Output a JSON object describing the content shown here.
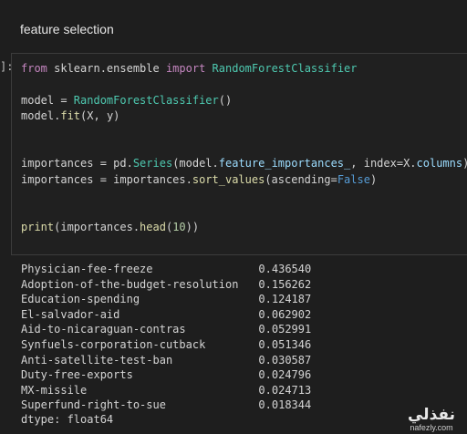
{
  "notebook": {
    "markdown_heading": "feature selection",
    "cell_prompt": "]:"
  },
  "code_cell": {
    "lines": [
      "from sklearn.ensemble import RandomForestClassifier",
      "",
      "model = RandomForestClassifier()",
      "model.fit(X, y)",
      "",
      "",
      "importances = pd.Series(model.feature_importances_, index=X.columns)",
      "importances = importances.sort_values(ascending=False)",
      "",
      "",
      "print(importances.head(10))"
    ]
  },
  "output": {
    "rows": [
      {
        "feature": "Physician-fee-freeze",
        "value": "0.436540"
      },
      {
        "feature": "Adoption-of-the-budget-resolution",
        "value": "0.156262"
      },
      {
        "feature": "Education-spending",
        "value": "0.124187"
      },
      {
        "feature": "El-salvador-aid",
        "value": "0.062902"
      },
      {
        "feature": "Aid-to-nicaraguan-contras",
        "value": "0.052991"
      },
      {
        "feature": "Synfuels-corporation-cutback",
        "value": "0.051346"
      },
      {
        "feature": "Anti-satellite-test-ban",
        "value": "0.030587"
      },
      {
        "feature": "Duty-free-exports",
        "value": "0.024796"
      },
      {
        "feature": "MX-missile",
        "value": "0.024713"
      },
      {
        "feature": "Superfund-right-to-sue",
        "value": "0.018344"
      }
    ],
    "dtype": "dtype: float64"
  },
  "watermark": {
    "logo_text": "نفذلي",
    "url": "nafezly.com"
  },
  "colors": {
    "background": "#1e1e1e",
    "keyword": "#c586c0",
    "function": "#dcdcaa",
    "class": "#4ec9b0",
    "attribute": "#9cdcfe",
    "number": "#b5cea8",
    "boolean": "#569cd6"
  }
}
